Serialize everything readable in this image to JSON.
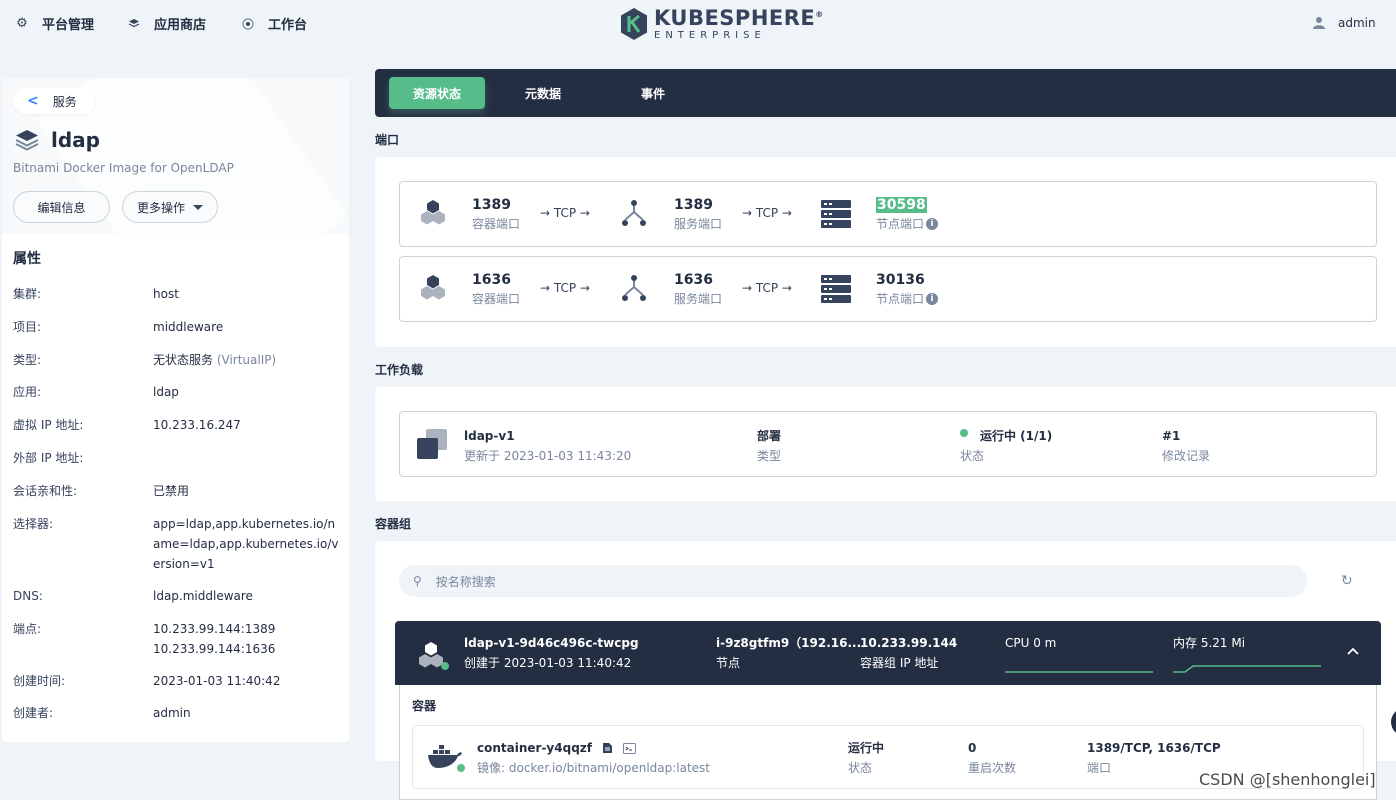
{
  "nav": {
    "platform": "平台管理",
    "appstore": "应用商店",
    "workbench": "工作台",
    "logo_main": "KUBESPHERE",
    "logo_reg": "®",
    "logo_sub": "ENTERPRISE",
    "user": "admin"
  },
  "left": {
    "back_label": "服务",
    "name": "ldap",
    "description": "Bitnami Docker Image for OpenLDAP",
    "edit_button": "编辑信息",
    "more_button": "更多操作",
    "attributes_title": "属性",
    "attributes": [
      {
        "key": "集群:",
        "value": "host"
      },
      {
        "key": "项目:",
        "value": "middleware"
      },
      {
        "key": "类型:",
        "value": "无状态服务",
        "value_extra": " (VirtualIP)"
      },
      {
        "key": "应用:",
        "value": "ldap"
      },
      {
        "key": "虚拟 IP 地址:",
        "value": "10.233.16.247"
      },
      {
        "key": "外部 IP 地址:",
        "value": ""
      },
      {
        "key": "会话亲和性:",
        "value": "已禁用"
      },
      {
        "key": "选择器:",
        "value": "app=ldap,app.kubernetes.io/name=ldap,app.kubernetes.io/version=v1"
      },
      {
        "key": "DNS:",
        "value": "ldap.middleware"
      },
      {
        "key": "端点:",
        "value": "10.233.99.144:1389",
        "value2": "10.233.99.144:1636"
      },
      {
        "key": "创建时间:",
        "value": "2023-01-03 11:40:42"
      },
      {
        "key": "创建者:",
        "value": "admin"
      }
    ]
  },
  "tabs": {
    "resource_status": "资源状态",
    "metadata": "元数据",
    "events": "事件"
  },
  "ports_section": {
    "title": "端口",
    "rows": [
      {
        "container_port": "1389",
        "container_label": "容器端口",
        "arrow": "→ TCP →",
        "service_port": "1389",
        "service_label": "服务端口",
        "node_port": "30598",
        "node_label": "节点端口"
      },
      {
        "container_port": "1636",
        "container_label": "容器端口",
        "arrow": "→ TCP →",
        "service_port": "1636",
        "service_label": "服务端口",
        "node_port": "30136",
        "node_label": "节点端口"
      }
    ]
  },
  "workload_section": {
    "title": "工作负载",
    "name": "ldap-v1",
    "updated": "更新于 2023-01-03 11:43:20",
    "kind": "部署",
    "kind_label": "类型",
    "status": "运行中 (1/1)",
    "status_label": "状态",
    "revision": "#1",
    "revision_label": "修改记录"
  },
  "pods_section": {
    "title": "容器组",
    "search_placeholder": "按名称搜索",
    "pod": {
      "name": "ldap-v1-9d46c496c-twcpg",
      "created": "创建于 2023-01-03 11:40:42",
      "node": "i-9z8gtfm9（192.16...",
      "node_label": "节点",
      "ip": "10.233.99.144",
      "ip_label": "容器组 IP 地址",
      "cpu": "CPU 0 m",
      "memory": "内存 5.21 Mi"
    },
    "containers_label": "容器",
    "container": {
      "name": "container-y4qqzf",
      "image": "镜像:  docker.io/bitnami/openldap:latest",
      "status": "运行中",
      "status_label": "状态",
      "restarts": "0",
      "restarts_label": "重启次数",
      "ports": "1389/TCP, 1636/TCP",
      "ports_label": "端口"
    }
  },
  "watermark": "CSDN @[shenhonglei]",
  "colors": {
    "accent": "#55bc8a",
    "dark": "#242e42",
    "muted": "#79879c",
    "background": "#eff4f9"
  }
}
